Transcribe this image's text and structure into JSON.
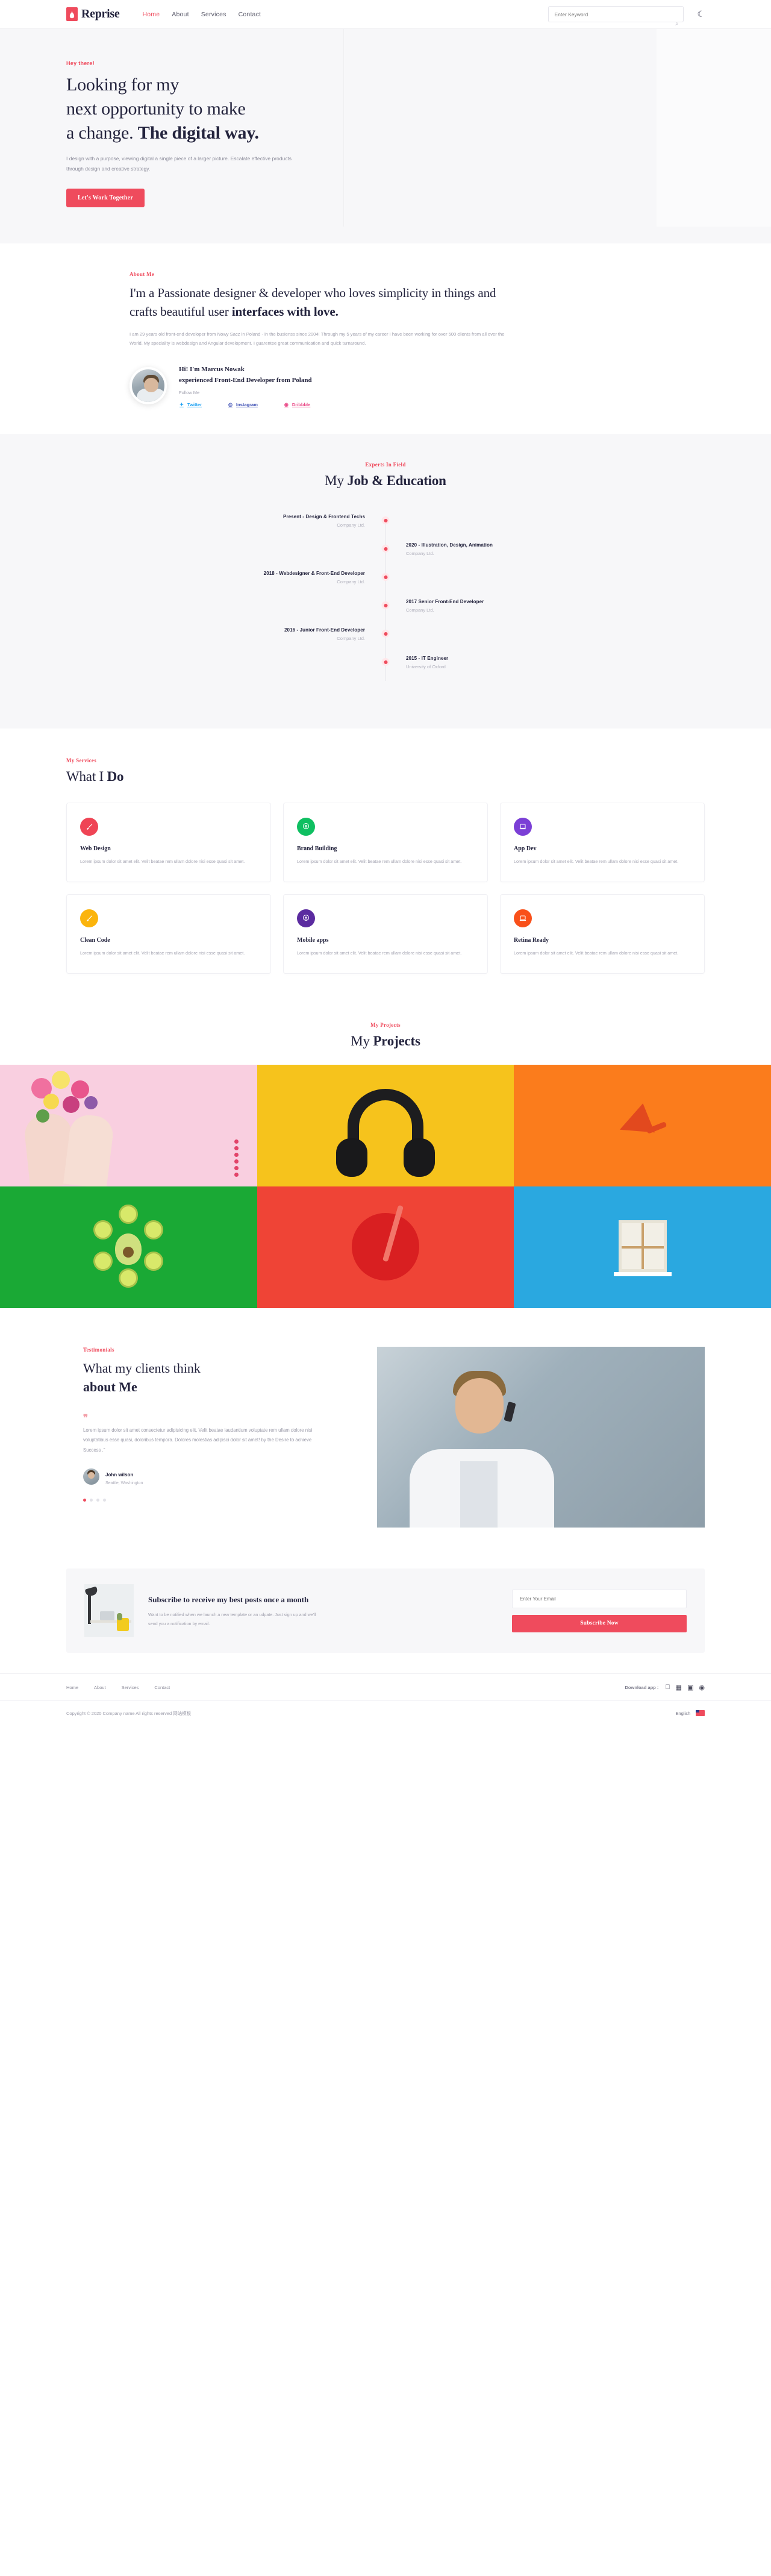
{
  "header": {
    "brand": "Reprise",
    "nav": [
      {
        "label": "Home",
        "active": true
      },
      {
        "label": "About",
        "active": false
      },
      {
        "label": "Services",
        "active": false
      },
      {
        "label": "Contact",
        "active": false
      }
    ],
    "search_placeholder": "Enter Keyword",
    "search_icon": "search-icon",
    "theme_icon": "moon-icon"
  },
  "hero": {
    "eyebrow": "Hey there!",
    "title_line1": "Looking for my",
    "title_line2": "next opportunity to make",
    "title_line3_light": "a change. ",
    "title_line3_bold": "The digital way.",
    "paragraph": "I design with a purpose, viewing digital a single piece of a larger picture. Escalate effective products through design and creative strategy.",
    "cta": "Let's Work Together"
  },
  "about": {
    "eyebrow": "About Me",
    "heading_light": "I'm a Passionate designer & developer who loves simplicity in things and crafts beautiful user ",
    "heading_bold": "interfaces with love.",
    "body": "I am 29 years old front-end developer from Nowy Sacz in Poland - in the busienss since 2004! Through my 5 years of my career I have been working for over 500 clients from all over the World. My speciality is webdesign and Angular development. I guarentee great communication and quick turnaround.",
    "profile": {
      "name_line1": "Hi! I'm Marcus Nowak",
      "name_line2": "experienced Front-End Developer from Poland",
      "follow_label": "Follow Me",
      "socials": [
        {
          "label": "Twitter",
          "icon": "twitter-icon",
          "color": "#1da1f2"
        },
        {
          "label": "Instagram",
          "icon": "instagram-icon",
          "color": "#3f51b5"
        },
        {
          "label": "Dribbble",
          "icon": "dribbble-icon",
          "color": "#ea4c89"
        }
      ]
    }
  },
  "timeline": {
    "eyebrow": "Experts In Field",
    "title_light": "My ",
    "title_bold": "Job & Education",
    "items": [
      {
        "side": "left",
        "title": "Present - Design & Frontend Techs",
        "sub": "Company Ltd."
      },
      {
        "side": "right",
        "title": "2020 - Illustration, Design, Animation",
        "sub": "Company Ltd."
      },
      {
        "side": "left",
        "title": "2018 - Webdesigner & Front-End Developer",
        "sub": "Company Ltd."
      },
      {
        "side": "right",
        "title": "2017 Senior Front-End Developer",
        "sub": "Company Ltd."
      },
      {
        "side": "left",
        "title": "2016 - Junior Front-End Developer",
        "sub": "Company Ltd."
      },
      {
        "side": "right",
        "title": "2015 - IT Engineer",
        "sub": "University of Oxford"
      }
    ]
  },
  "services": {
    "eyebrow": "My Services",
    "title_light": "What I ",
    "title_bold": "Do",
    "cards": [
      {
        "name": "Web Design",
        "icon": "brush-icon",
        "color": "#ef4455",
        "desc": "Lorem ipsum dolor sit amet elit. Velit beatae rem ullam dolore nisi esse quasi sit amet."
      },
      {
        "name": "Brand Building",
        "icon": "bulb-icon",
        "color": "#0fbf61",
        "desc": "Lorem ipsum dolor sit amet elit. Velit beatae rem ullam dolore nisi esse quasi sit amet."
      },
      {
        "name": "App Dev",
        "icon": "laptop-icon",
        "color": "#7b3fd6",
        "desc": "Lorem ipsum dolor sit amet elit. Velit beatae rem ullam dolore nisi esse quasi sit amet."
      },
      {
        "name": "Clean Code",
        "icon": "brush-icon",
        "color": "#fbb40c",
        "desc": "Lorem ipsum dolor sit amet elit. Velit beatae rem ullam dolore nisi esse quasi sit amet."
      },
      {
        "name": "Mobile apps",
        "icon": "bulb-icon",
        "color": "#5b2ba0",
        "desc": "Lorem ipsum dolor sit amet elit. Velit beatae rem ullam dolore nisi esse quasi sit amet."
      },
      {
        "name": "Retina Ready",
        "icon": "laptop-icon",
        "color": "#f9501a",
        "desc": "Lorem ipsum dolor sit amet elit. Velit beatae rem ullam dolore nisi esse quasi sit amet."
      }
    ]
  },
  "projects": {
    "eyebrow": "My Projects",
    "title_light": "My ",
    "title_bold": "Projects",
    "tiles": [
      {
        "name": "flowers-in-hands",
        "color": "#f9cfe0"
      },
      {
        "name": "headphones",
        "color": "#f6c31c"
      },
      {
        "name": "megaphone",
        "color": "#fb7c1c"
      },
      {
        "name": "kiwi-avocado",
        "color": "#1aa935"
      },
      {
        "name": "red-drink",
        "color": "#ef4436"
      },
      {
        "name": "window-model",
        "color": "#2aa8e0"
      }
    ]
  },
  "testimonials": {
    "eyebrow": "Testimonials",
    "title_light": "What my clients think",
    "title_bold": "about Me",
    "quote_mark": "❞",
    "quote": "Lorem ipsum dolor sit amet consectetur adipisicing elit. Velit beatae laudantium voluptate rem ullam dolore nisi voluptatibus esse quasi, doloribus tempora. Dolores molestias adipisci dolor sit amet! by the Desire to achieve Success .\"",
    "author_name": "John wilson",
    "author_role": "Seattle, Washington",
    "dots": 4,
    "active_dot": 0
  },
  "subscribe": {
    "heading": "Subscribe to receive my best posts once a month",
    "body": "Want to be notified when we launch a new template or an udpate. Just sign up and we'll send you a notification by email.",
    "input_placeholder": "Enter Your Email",
    "button": "Subscribe Now"
  },
  "footer": {
    "nav": [
      "Home",
      "About",
      "Services",
      "Contact"
    ],
    "download_label": "Download app :",
    "download_icons": [
      "apple-icon",
      "windows-icon",
      "android-icon",
      "linux-icon"
    ],
    "copyright": "Copyright © 2020 Company name All rights reserved 网站模板",
    "language": "English",
    "flag_icon": "flag-icon"
  }
}
